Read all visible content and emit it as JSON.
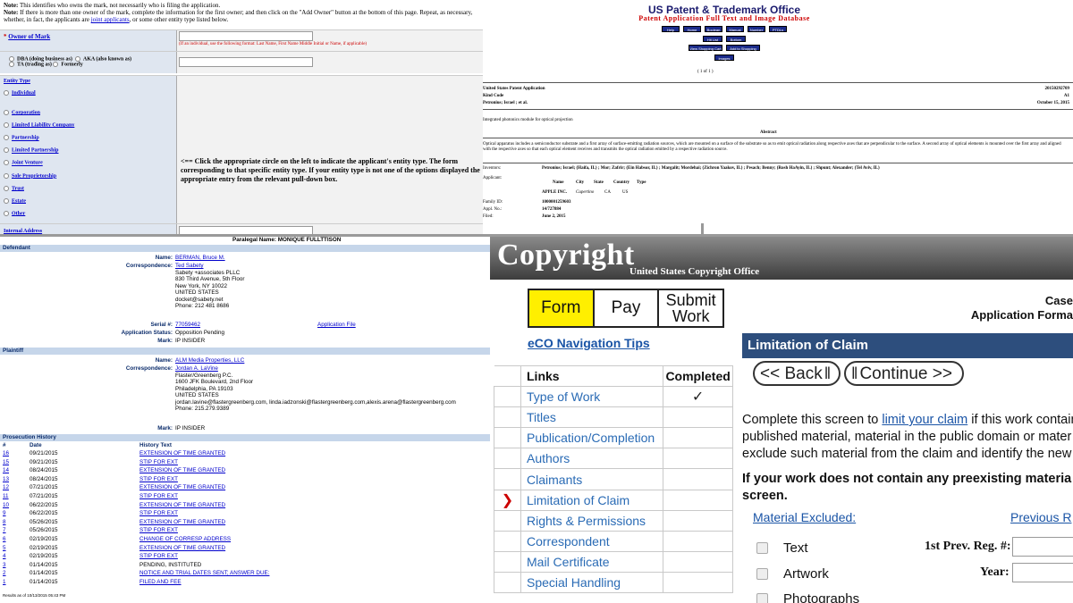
{
  "trademark": {
    "note1_prefix": "Note:",
    "note1": "This identifies who owns the mark, not necessarily who is filing the application.",
    "note2_prefix": "Note:",
    "note2": "If there is more than one owner of the mark, complete the information for the first owner; and then click on the \"Add Owner\" button at the bottom of this page. Repeat, as necessary,",
    "note3": "whether, in fact, the applicants are",
    "note3_link": "joint applicants",
    "note3_end": ", or some other entity type listed below.",
    "owner_label": "Owner of Mark",
    "owner_hint": "(If an individual, use the following format: Last Name, First Name Middle Initial or Name, if applicable)",
    "dba": "DBA (doing business as)",
    "aka": "AKA (also known as)",
    "ta": "TA (trading as)",
    "formerly": "Formerly",
    "entity_type": "Entity Type",
    "entities": [
      "Individual",
      "Corporation",
      "Limited Liability Company",
      "Partnership",
      "Limited Partnership",
      "Joint Venture",
      "Sole Proprietorship",
      "Trust",
      "Estate",
      "Other"
    ],
    "instruction": "<== Click the appropriate circle on the left to indicate the applicant's entity type. The form corresponding to that specific entity type. If your entity type is not one of the options displayed the appropriate entry from the relevant pull-down box.",
    "internal_address": "Internal Address"
  },
  "patent": {
    "title": "US Patent & Trademark Office",
    "subtitle": "Patent Application Full Text and Image Database",
    "buttons_row1": [
      "Help",
      "Home",
      "Boolean",
      "Manual",
      "Number",
      "PTDLs"
    ],
    "buttons_row2": [
      "Hit List",
      "Bottom"
    ],
    "buttons_row3": [
      "View Shopping Cart",
      "Add to Shopping Cart"
    ],
    "buttons_row4": [
      "Images"
    ],
    "page": "( 1 of 1 )",
    "app_type": "United States Patent Application",
    "app_number": "20150292709",
    "kind_label": "Kind Code",
    "kind_value": "A1",
    "inventors_short": "Petronius; Israel ;   et al.",
    "date": "October 15, 2015",
    "invention_title": "Integrated photonics module for optical projection",
    "abstract_label": "Abstract",
    "abstract": "Optical apparatus includes a semiconductor substrate and a first array of surface-emitting radiation sources, which are mounted on a surface of the substrate so as to emit optical radiation along respective axes that are perpendicular to the surface. A second array of optical elements is mounted over the first array and aligned with the respective axes so that each optical element receives and transmits the optical radiation emitted by a respective radiation source.",
    "inventors_label": "Inventors:",
    "inventors": "Petronius; Israel; (Haifa, IL) ; Mor; Zafrir; (Ein Habsor, IL) ; Margalit; Mordehai; (Zichron Yaakov, IL) ; Pesach; Benny; (Rosh HaAyin, IL) ; Shpunt; Alexander; (Tel Aviv, IL)",
    "applicant_label": "Applicant:",
    "applicant_cols": [
      "Name",
      "City",
      "State",
      "Country",
      "Type"
    ],
    "applicant_name": "APPLE INC.",
    "applicant_city": "Cupertino",
    "applicant_state": "CA",
    "applicant_country": "US",
    "family_label": "Family ID:",
    "family_value": "1000001259603",
    "appl_label": "Appl. No.:",
    "appl_value": "14/727884",
    "filed_label": "Filed:",
    "filed_value": "June 2, 2015"
  },
  "ttab": {
    "paralegal": "Paralegal Name: MONIQUE FULLTTISON",
    "defendant_header": "Defendant",
    "name_label": "Name:",
    "def_name": "BERMAN, Bruce M.",
    "corr_label": "Correspondence:",
    "def_corr": [
      "Ted Sabety",
      "Sabety +associates PLLC",
      "830 Third Avenue, 5th Floor",
      "New York, NY 10022",
      "UNITED STATES",
      "docket@sabety.net",
      "Phone: 212 481 8686"
    ],
    "serial_label": "Serial #:",
    "serial": "77059462",
    "app_file": "Application File",
    "status_label": "Application Status:",
    "status": "Opposition Pending",
    "mark_label": "Mark:",
    "mark": "IP INSIDER",
    "plaintiff_header": "Plaintiff",
    "pl_name": "ALM Media Properties, LLC",
    "pl_corr": [
      "Jordan A. LaVine",
      "Flaster/Greenberg P.C.",
      "1600 JFK Boulevard, 2nd Floor",
      "Philadelphia, PA 19103",
      "UNITED STATES",
      "jordan.lavine@flastergreenberg.com, linda.iadzonski@flastergreenberg.com,alexis.arena@flastergreenberg.com",
      "Phone: 215.279.9389"
    ],
    "pl_mark": "IP INSIDER",
    "history_header": "Prosecution History",
    "cols": [
      "#",
      "Date",
      "History Text"
    ],
    "rows": [
      [
        "16",
        "09/21/2015",
        "EXTENSION OF TIME GRANTED",
        true
      ],
      [
        "15",
        "09/21/2015",
        "STIP FOR EXT",
        true
      ],
      [
        "14",
        "08/24/2015",
        "EXTENSION OF TIME GRANTED",
        true
      ],
      [
        "13",
        "08/24/2015",
        "STIP FOR EXT",
        true
      ],
      [
        "12",
        "07/21/2015",
        "EXTENSION OF TIME GRANTED",
        true
      ],
      [
        "11",
        "07/21/2015",
        "STIP FOR EXT",
        true
      ],
      [
        "10",
        "06/22/2015",
        "EXTENSION OF TIME GRANTED",
        true
      ],
      [
        "9",
        "06/22/2015",
        "STIP FOR EXT",
        true
      ],
      [
        "8",
        "05/26/2015",
        "EXTENSION OF TIME GRANTED",
        true
      ],
      [
        "7",
        "05/26/2015",
        "STIP FOR EXT",
        true
      ],
      [
        "6",
        "02/19/2015",
        "CHANGE OF CORRESP ADDRESS",
        true
      ],
      [
        "5",
        "02/19/2015",
        "EXTENSION OF TIME GRANTED",
        true
      ],
      [
        "4",
        "02/19/2015",
        "STIP FOR EXT",
        true
      ],
      [
        "3",
        "01/14/2015",
        "PENDING, INSTITUTED",
        false
      ],
      [
        "2",
        "01/14/2015",
        "NOTICE AND TRIAL DATES SENT; ANSWER DUE:",
        true
      ],
      [
        "1",
        "01/14/2015",
        "FILED AND FEE",
        true
      ]
    ],
    "footer": "Results as of 10/13/2015 05:43 PM"
  },
  "copyright": {
    "logo": "Copyright",
    "office": "United States Copyright Office",
    "tabs": [
      "Form",
      "Pay",
      "Submit Work"
    ],
    "nav_tips": "eCO Navigation Tips",
    "links_header": "Links",
    "completed_header": "Completed",
    "links": [
      "Type of Work",
      "Titles",
      "Publication/Completion",
      "Authors",
      "Claimants",
      "Limitation of Claim",
      "Rights & Permissions",
      "Correspondent",
      "Mail Certificate",
      "Special Handling"
    ],
    "completed_mark": "✓",
    "current_arrow": "❯",
    "case_text": "Case",
    "app_form_text": "Application Forma",
    "title_bar": "Limitation of Claim",
    "back": "<< Back",
    "continue": "Continue >>",
    "para_pre": "Complete this screen to ",
    "para_link": "limit your claim",
    "para_post": " if this work contain published material, material in the public domain or mater exclude such material from the claim and identify the new",
    "bold_para": "If your work does not contain any preexisting materia screen.",
    "material_excluded": "Material Excluded:",
    "previous_reg": "Previous R",
    "materials": [
      "Text",
      "Artwork",
      "Photographs"
    ],
    "first_prev_reg": "1st Prev. Reg. #:",
    "year": "Year:"
  }
}
